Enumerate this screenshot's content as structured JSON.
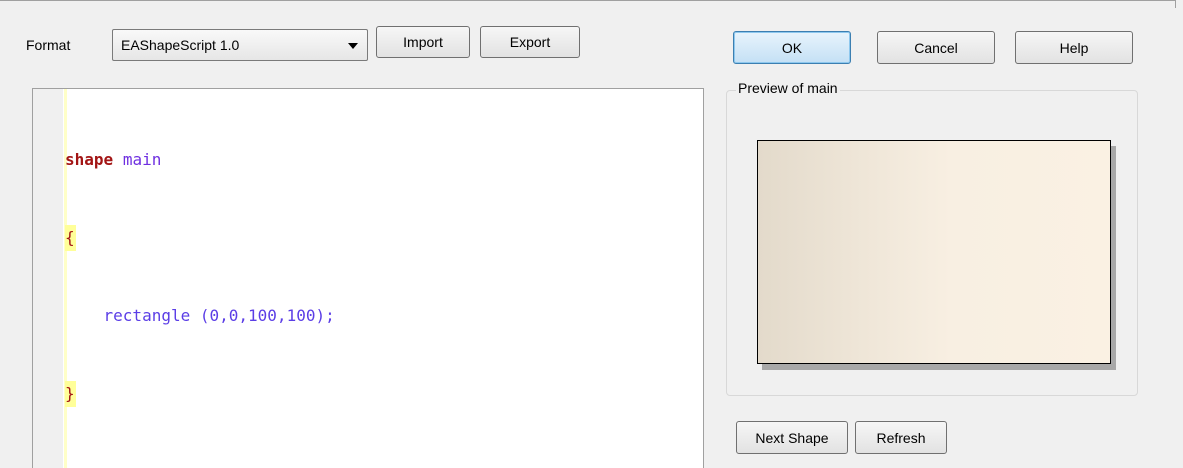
{
  "toolbar": {
    "format_label": "Format",
    "format_selected": "EAShapeScript 1.0",
    "import_label": "Import",
    "export_label": "Export"
  },
  "dialog_buttons": {
    "ok_label": "OK",
    "cancel_label": "Cancel",
    "help_label": "Help"
  },
  "editor": {
    "lines": [
      {
        "keyword": "shape",
        "name": "main"
      },
      {
        "brace": "{"
      },
      {
        "indent": "    ",
        "fn": "rectangle",
        "args": " (0,0,100,100);"
      },
      {
        "brace": "}"
      }
    ]
  },
  "preview": {
    "group_label": "Preview of main",
    "fill_gradient": [
      "#e3dacb",
      "#faf1e3"
    ]
  },
  "bottom_buttons": {
    "next_shape_label": "Next Shape",
    "refresh_label": "Refresh"
  },
  "colors": {
    "keyword": "#a31515",
    "identifier": "#6e2fe0",
    "brace_highlight": "#ffff99",
    "ok_accent": "#3c7fb1"
  }
}
